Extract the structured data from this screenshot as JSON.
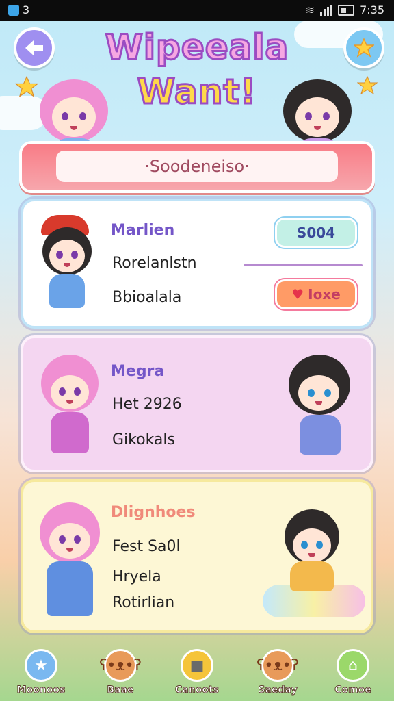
{
  "status_bar": {
    "left_text": "3",
    "time": "7:35"
  },
  "header": {
    "title_line1": "Wipeeala",
    "title_line2": "Want!",
    "subtitle": "·Soodeneiso·"
  },
  "cards": [
    {
      "name": "Marlien",
      "line1": "Rorelanlstn",
      "line2": "Bbioalala",
      "badge1": "S004",
      "badge2": "Ioxe"
    },
    {
      "name": "Megra",
      "line1": "Het 2926",
      "line2": "Gikokals"
    },
    {
      "name": "Dlignhoes",
      "line1": "Fest Sa0l",
      "line2": "Hryela",
      "line3": "Rotirlian"
    }
  ],
  "nav": [
    {
      "label": "Moonoos",
      "icon": "star-icon"
    },
    {
      "label": "Baae",
      "icon": "bear-icon"
    },
    {
      "label": "Canoots",
      "icon": "gift-icon"
    },
    {
      "label": "Saeday",
      "icon": "bear-icon"
    },
    {
      "label": "Comoe",
      "icon": "home-icon"
    }
  ],
  "colors": {
    "accent": "#9b4cc2",
    "banner": "#f87c86"
  }
}
